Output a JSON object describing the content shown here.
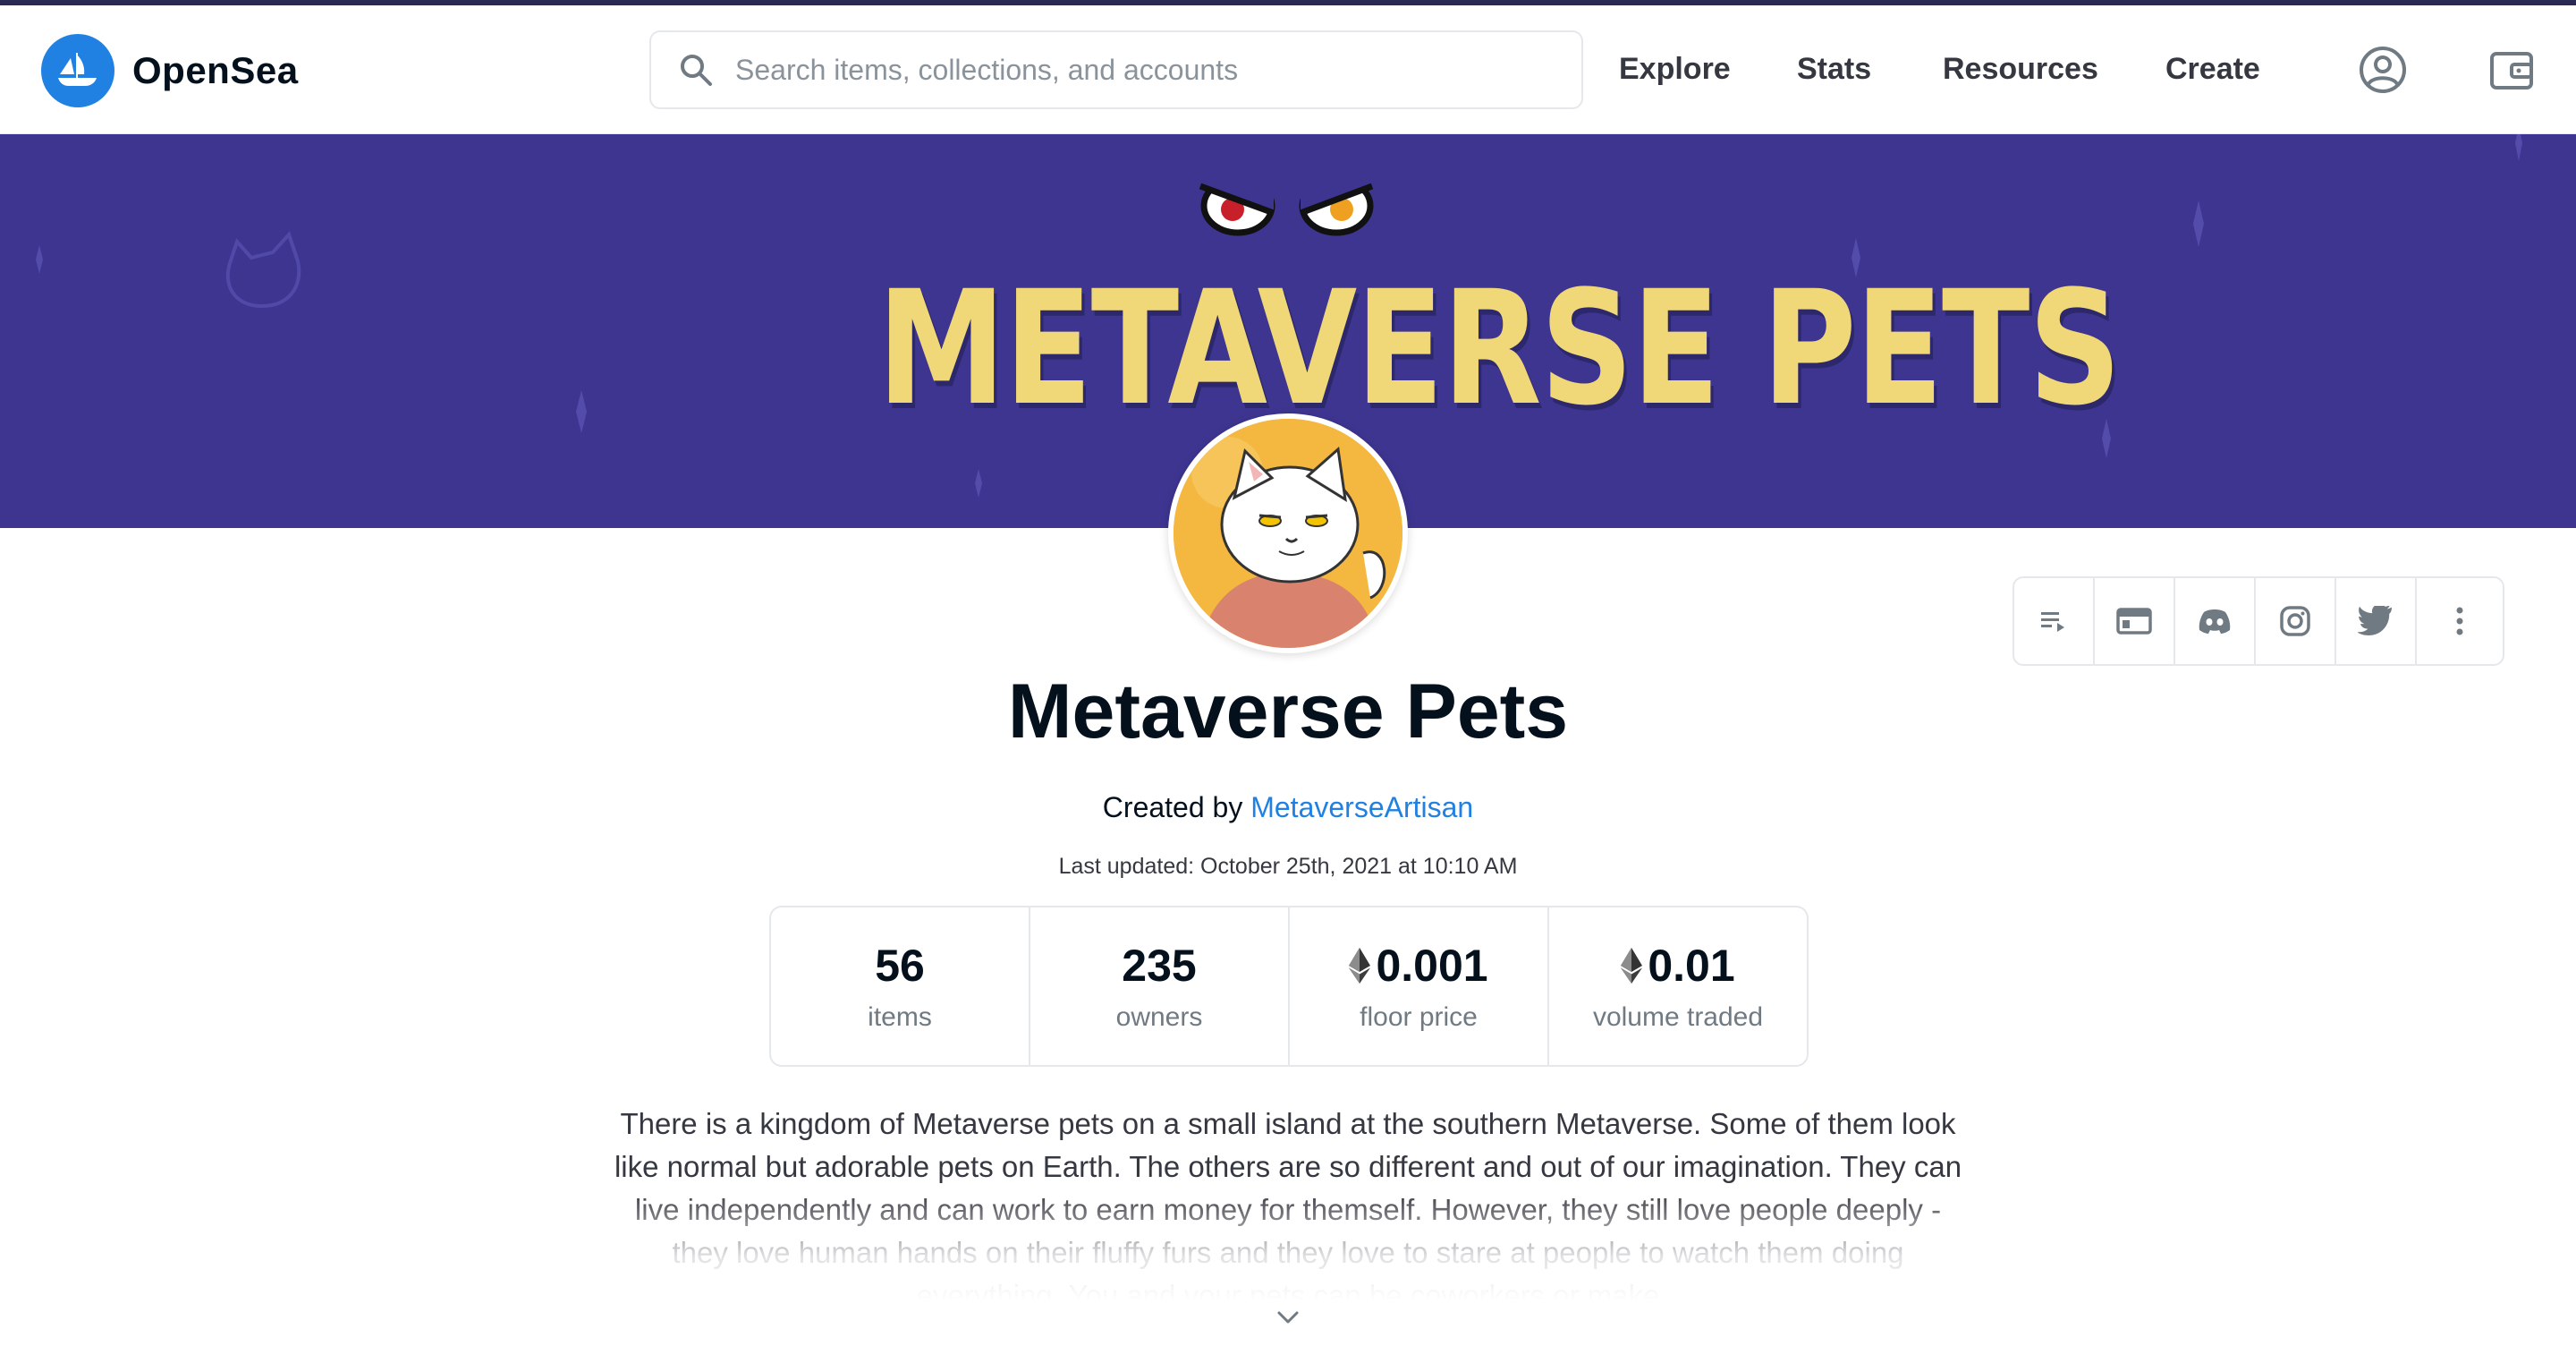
{
  "app": {
    "name": "OpenSea",
    "accent_color": "#2081e2"
  },
  "navbar": {
    "search_placeholder": "Search items, collections, and accounts",
    "links": [
      "Explore",
      "Stats",
      "Resources",
      "Create"
    ],
    "icons": [
      "account-icon",
      "wallet-icon"
    ]
  },
  "banner": {
    "title": "METAVERSE PETS",
    "background_color": "#3d3590",
    "title_color": "#f0d778"
  },
  "social_links": [
    "activity-icon",
    "website-icon",
    "discord-icon",
    "instagram-icon",
    "twitter-icon",
    "more-icon"
  ],
  "collection": {
    "title": "Metaverse Pets",
    "created_by_label": "Created by",
    "creator": "MetaverseArtisan",
    "last_updated": "Last updated: October 25th, 2021 at 10:10 AM"
  },
  "stats": [
    {
      "value": "56",
      "label": "items",
      "eth": false
    },
    {
      "value": "235",
      "label": "owners",
      "eth": false
    },
    {
      "value": "0.001",
      "label": "floor price",
      "eth": true
    },
    {
      "value": "0.01",
      "label": "volume traded",
      "eth": true
    }
  ],
  "description": "There is a kingdom of Metaverse pets on a small island at the southern Metaverse. Some of them look like normal but adorable pets on Earth. The others are so different and out of our imagination. They can live independently and can work to earn money for themself. However, they still love people deeply - they love human hands on their fluffy furs and they love to stare at people to watch them doing everything. You and your pets can be coworkers or make"
}
